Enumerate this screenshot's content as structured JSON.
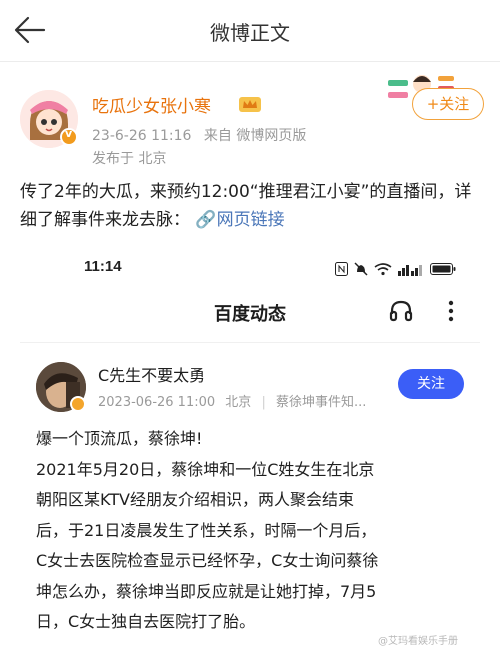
{
  "topbar": {
    "title": "微博正文",
    "back_icon": "back-arrow-icon"
  },
  "post": {
    "author": "吃瓜少女张小寒",
    "badge_icon": "crown-icon",
    "date": "23-6-26 11:16",
    "source": "来自 微博网页版",
    "location": "发布于 北京",
    "follow_label": "+关注",
    "text": "传了2年的大瓜，来预约12:00“推理君江小宴”的直播间，详细了解事件来龙去脉：",
    "link_label": "网页链接"
  },
  "embedded": {
    "status_time": "11:14",
    "status_icons": [
      "nfc-icon",
      "mute-icon",
      "wifi-6-icon",
      "signal-icon",
      "battery-icon"
    ],
    "title": "百度动态",
    "author": "C先生不要太勇",
    "date": "2023-06-26 11:00",
    "location": "北京",
    "topic": "蔡徐坤事件知...",
    "follow_label": "关注",
    "lines": [
      "爆一个顶流瓜，蔡徐坤!",
      "2021年5月20日，蔡徐坤和一位C姓女生在北京",
      "朝阳区某KTV经朋友介绍相识，两人聚会结束",
      "后，于21日凌晨发生了性关系，时隔一个月后，",
      "C女士去医院检查显示已经怀孕，C女士询问蔡徐",
      "坤怎么办，蔡徐坤当即反应就是让她打掉，7月5",
      "日，C女士独自去医院打了胎。"
    ]
  },
  "watermark": "@艾玛看娱乐手册",
  "colors": {
    "author_orange": "#e8730d",
    "link_blue": "#4a76b8",
    "follow_blue": "#3b5ef7"
  }
}
